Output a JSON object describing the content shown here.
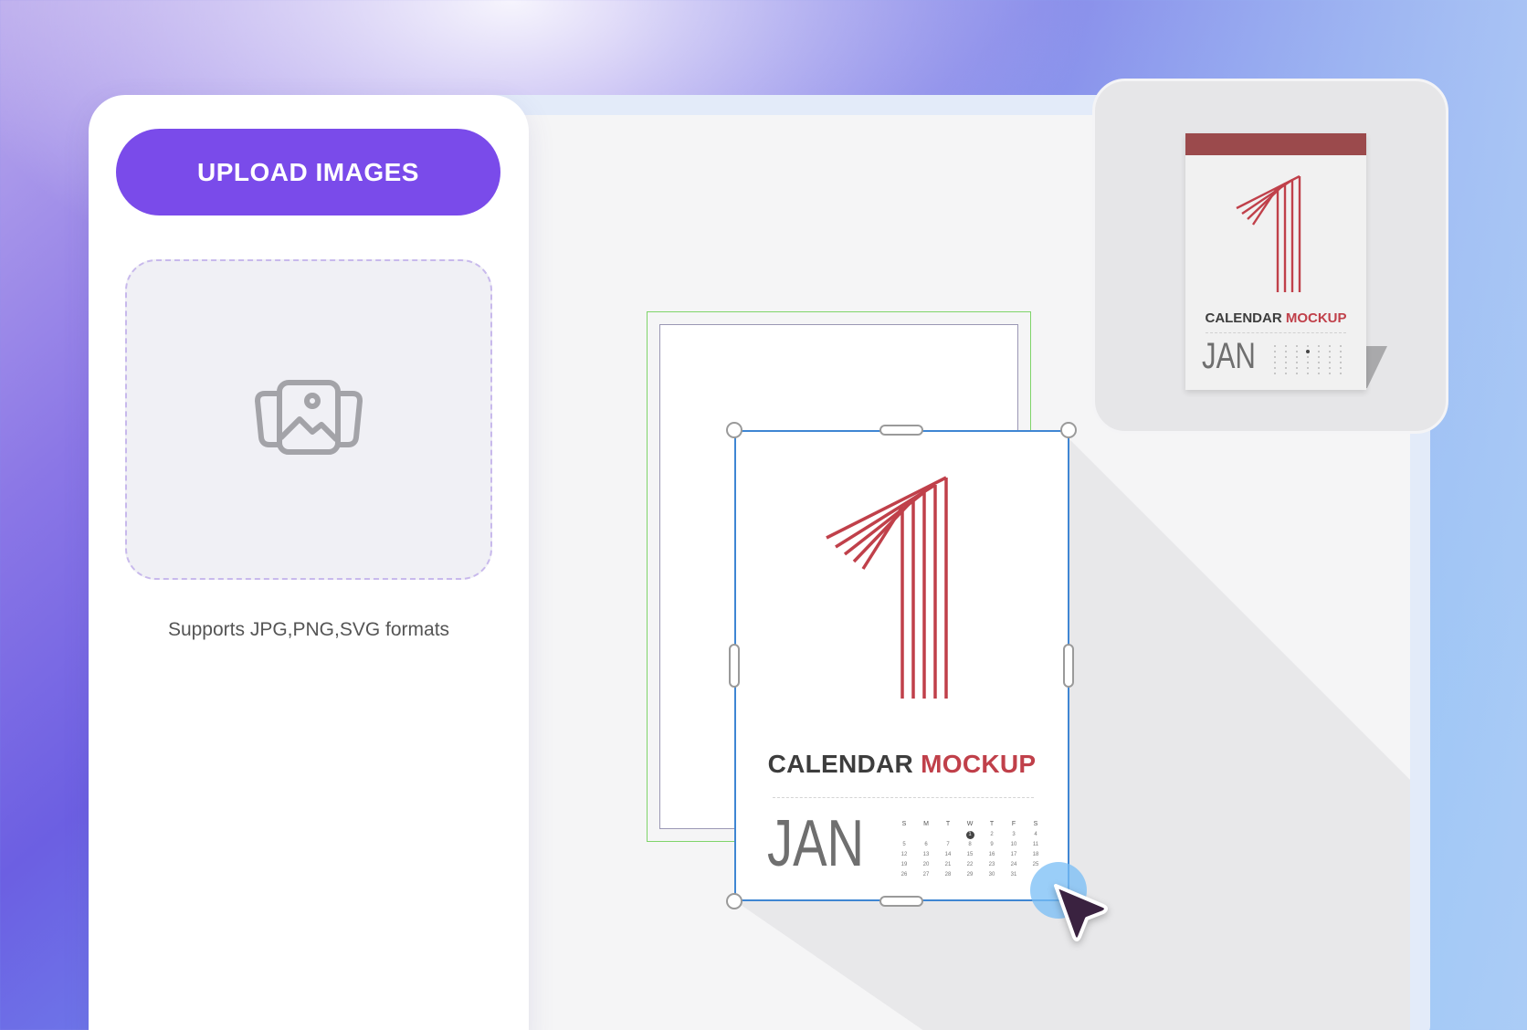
{
  "left_panel": {
    "upload_button": "UPLOAD IMAGES",
    "formats_text": "Supports JPG,PNG,SVG formats"
  },
  "calendar": {
    "title_part1": "CALENDAR",
    "title_part2": "MOCKUP",
    "month": "JAN",
    "day_headers": [
      "S",
      "M",
      "T",
      "W",
      "T",
      "F",
      "S"
    ],
    "days": [
      "",
      "",
      "",
      "1",
      "2",
      "3",
      "4",
      "5",
      "6",
      "7",
      "8",
      "9",
      "10",
      "11",
      "12",
      "13",
      "14",
      "15",
      "16",
      "17",
      "18",
      "19",
      "20",
      "21",
      "22",
      "23",
      "24",
      "25",
      "26",
      "27",
      "28",
      "29",
      "30",
      "31",
      ""
    ],
    "highlighted_day": "1"
  },
  "preview": {
    "title_part1": "CALENDAR",
    "title_part2": "MOCKUP",
    "month": "JAN"
  },
  "colors": {
    "accent_purple": "#7a4bea",
    "calendar_red": "#c0404a",
    "selection_blue": "#3f86d3",
    "frame_green": "#7fd46a"
  },
  "icons": [
    "gallery-image-icon",
    "pointer-cursor-icon"
  ]
}
